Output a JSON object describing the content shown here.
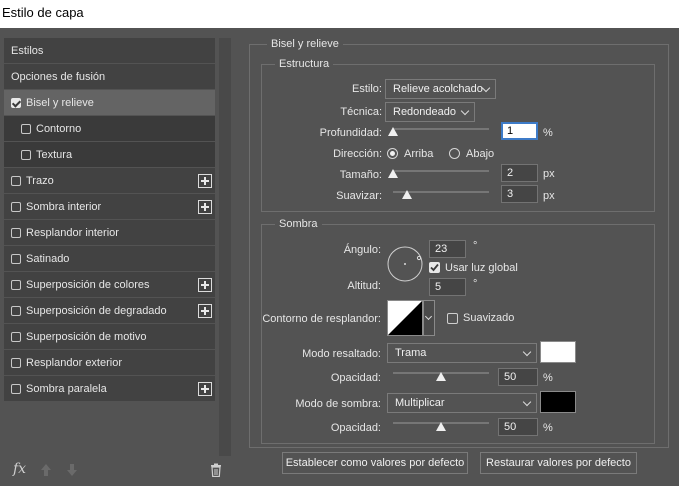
{
  "window": {
    "title": "Estilo de capa"
  },
  "sidebar": {
    "items": [
      {
        "label": "Estilos",
        "checkbox": false,
        "checked": false,
        "plus": false,
        "selected": false,
        "sub": false
      },
      {
        "label": "Opciones de fusión",
        "checkbox": false,
        "checked": false,
        "plus": false,
        "selected": false,
        "sub": false
      },
      {
        "label": "Bisel y relieve",
        "checkbox": true,
        "checked": true,
        "plus": false,
        "selected": true,
        "sub": false
      },
      {
        "label": "Contorno",
        "checkbox": true,
        "checked": false,
        "plus": false,
        "selected": false,
        "sub": true
      },
      {
        "label": "Textura",
        "checkbox": true,
        "checked": false,
        "plus": false,
        "selected": false,
        "sub": true
      },
      {
        "label": "Trazo",
        "checkbox": true,
        "checked": false,
        "plus": true,
        "selected": false,
        "sub": false
      },
      {
        "label": "Sombra interior",
        "checkbox": true,
        "checked": false,
        "plus": true,
        "selected": false,
        "sub": false
      },
      {
        "label": "Resplandor interior",
        "checkbox": true,
        "checked": false,
        "plus": false,
        "selected": false,
        "sub": false
      },
      {
        "label": "Satinado",
        "checkbox": true,
        "checked": false,
        "plus": false,
        "selected": false,
        "sub": false
      },
      {
        "label": "Superposición de colores",
        "checkbox": true,
        "checked": false,
        "plus": true,
        "selected": false,
        "sub": false
      },
      {
        "label": "Superposición de degradado",
        "checkbox": true,
        "checked": false,
        "plus": true,
        "selected": false,
        "sub": false
      },
      {
        "label": "Superposición de motivo",
        "checkbox": true,
        "checked": false,
        "plus": false,
        "selected": false,
        "sub": false
      },
      {
        "label": "Resplandor exterior",
        "checkbox": true,
        "checked": false,
        "plus": false,
        "selected": false,
        "sub": false
      },
      {
        "label": "Sombra paralela",
        "checkbox": true,
        "checked": false,
        "plus": true,
        "selected": false,
        "sub": false
      }
    ]
  },
  "bottom_bar": {
    "fx_label": "fx"
  },
  "bevel": {
    "group_title": "Bisel y relieve",
    "structure": {
      "title": "Estructura",
      "style_label": "Estilo:",
      "style_value": "Relieve acolchado",
      "technique_label": "Técnica:",
      "technique_value": "Redondeado",
      "depth_label": "Profundidad:",
      "depth_value": "1",
      "depth_unit": "%",
      "depth_level": 0.0,
      "direction_label": "Dirección:",
      "direction_up": "Arriba",
      "direction_down": "Abajo",
      "direction_selected": "up",
      "size_label": "Tamaño:",
      "size_value": "2",
      "size_unit": "px",
      "size_level": 0.0,
      "soften_label": "Suavizar:",
      "soften_value": "3",
      "soften_unit": "px",
      "soften_level": 0.15
    },
    "shading": {
      "title": "Sombra",
      "angle_label": "Ángulo:",
      "angle_value": "23",
      "angle_unit": "°",
      "global_light_label": "Usar luz global",
      "global_light_checked": true,
      "altitude_label": "Altitud:",
      "altitude_value": "5",
      "altitude_unit": "°",
      "gloss_label": "Contorno de resplandor:",
      "antialiased_label": "Suavizado",
      "antialiased_checked": false,
      "highlight_mode_label": "Modo resaltado:",
      "highlight_mode_value": "Trama",
      "highlight_color": "#ffffff",
      "highlight_opacity_label": "Opacidad:",
      "highlight_opacity_value": "50",
      "highlight_opacity_unit": "%",
      "highlight_opacity_level": 0.5,
      "shadow_mode_label": "Modo de sombra:",
      "shadow_mode_value": "Multiplicar",
      "shadow_color": "#000000",
      "shadow_opacity_label": "Opacidad:",
      "shadow_opacity_value": "50",
      "shadow_opacity_unit": "%",
      "shadow_opacity_level": 0.5
    }
  },
  "actions": {
    "make_default": "Establecer como valores por defecto",
    "reset_default": "Restaurar valores por defecto"
  },
  "icons": {
    "fx": "fx-icon",
    "up": "arrow-up-icon",
    "down": "arrow-down-icon",
    "trash": "trash-icon",
    "plus": "plus-icon",
    "check": "check-icon"
  }
}
